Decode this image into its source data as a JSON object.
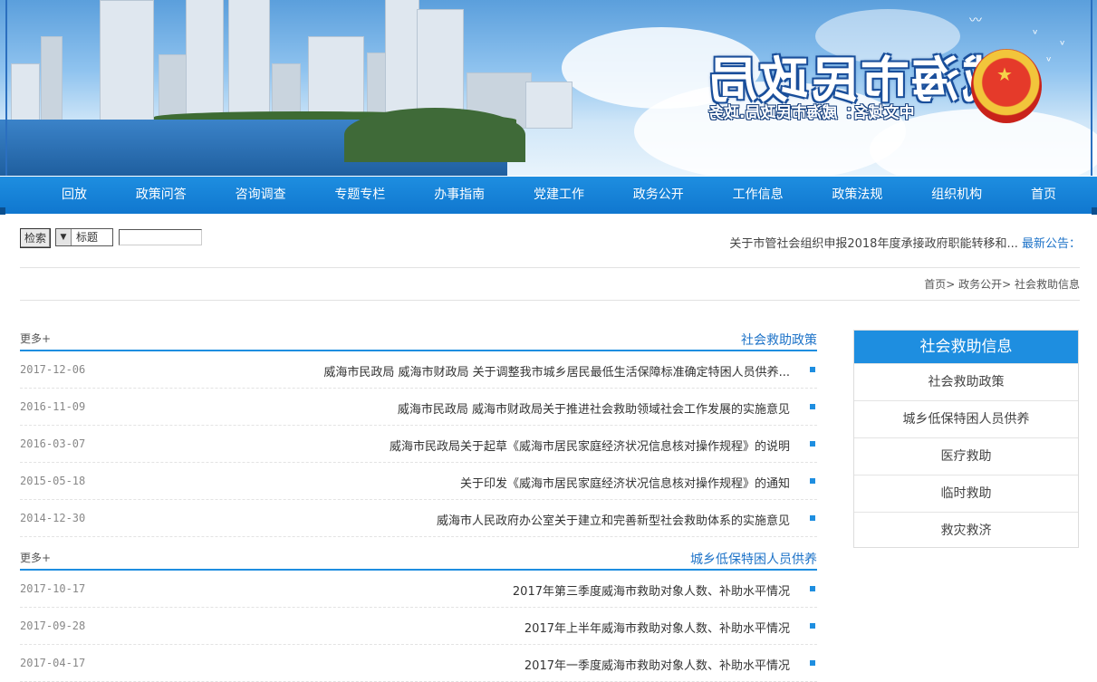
{
  "banner": {
    "title": "威海市民政局",
    "domain": "中文域名：威海市民政局.政务"
  },
  "nav": {
    "items": [
      "首页",
      "组织机构",
      "政策法规",
      "工作信息",
      "政务公开",
      "党建工作",
      "办事指南",
      "专题专栏",
      "咨询调查",
      "政策问答",
      "回放"
    ]
  },
  "search": {
    "button_label": "检索",
    "type_value": "标题",
    "input_value": ""
  },
  "notice": {
    "label": "最新公告：",
    "text": "关于市管社会组织申报2018年度承接政府职能转移和..."
  },
  "breadcrumb": "首页> 政务公开> 社会救助信息",
  "panels": [
    {
      "title": "社会救助政策",
      "more": "更多+",
      "rows": [
        {
          "text": "威海市民政局 威海市财政局 关于调整我市城乡居民最低生活保障标准确定特困人员供养...",
          "date": "2017-12-06"
        },
        {
          "text": "威海市民政局 威海市财政局关于推进社会救助领域社会工作发展的实施意见",
          "date": "2016-11-09"
        },
        {
          "text": "威海市民政局关于起草《威海市居民家庭经济状况信息核对操作规程》的说明",
          "date": "2016-03-07"
        },
        {
          "text": "关于印发《威海市居民家庭经济状况信息核对操作规程》的通知",
          "date": "2015-05-18"
        },
        {
          "text": "威海市人民政府办公室关于建立和完善新型社会救助体系的实施意见",
          "date": "2014-12-30"
        }
      ]
    },
    {
      "title": "城乡低保特困人员供养",
      "more": "更多+",
      "rows": [
        {
          "text": "2017年第三季度威海市救助对象人数、补助水平情况",
          "date": "2017-10-17"
        },
        {
          "text": "2017年上半年威海市救助对象人数、补助水平情况",
          "date": "2017-09-28"
        },
        {
          "text": "2017年一季度威海市救助对象人数、补助水平情况",
          "date": "2017-04-17"
        }
      ]
    }
  ],
  "sidebar": {
    "heading": "社会救助信息",
    "items": [
      "社会救助政策",
      "城乡低保特困人员供养",
      "医疗救助",
      "临时救助",
      "救灾救济"
    ]
  },
  "colors": {
    "accent": "#1e8ee0",
    "link_blue": "#1e73c8"
  }
}
